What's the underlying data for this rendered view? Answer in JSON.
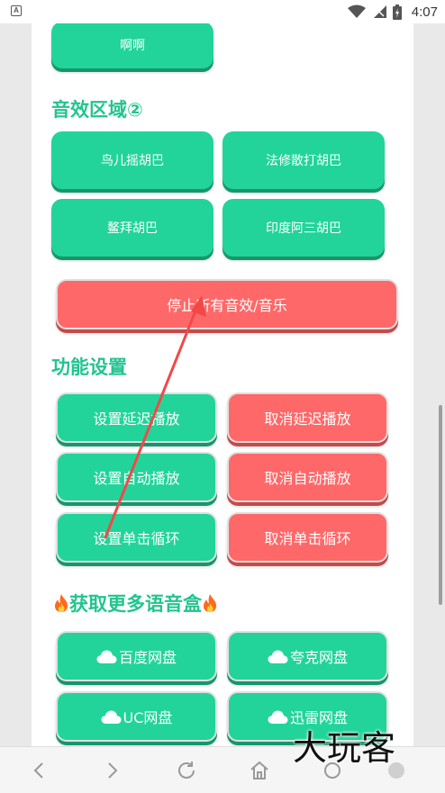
{
  "status_bar": {
    "time": "4:07",
    "app_icon": "A"
  },
  "top_partial": {
    "button_label": "啊啊"
  },
  "sound_section": {
    "title": "音效区域②",
    "buttons": [
      "鸟儿摇胡巴",
      "法修散打胡巴",
      "鳌拜胡巴",
      "印度阿三胡巴"
    ]
  },
  "stop_button": {
    "label": "停止所有音效/音乐"
  },
  "settings_section": {
    "title": "功能设置",
    "buttons": {
      "set_delay": "设置延迟播放",
      "cancel_delay": "取消延迟播放",
      "set_auto": "设置自动播放",
      "cancel_auto": "取消自动播放",
      "set_loop": "设置单击循环",
      "cancel_loop": "取消单击循环"
    }
  },
  "more_section": {
    "title": "获取更多语音盒",
    "buttons": [
      "百度网盘",
      "夸克网盘",
      "UC网盘",
      "迅雷网盘"
    ]
  },
  "watermark": "大玩客",
  "colors": {
    "green": "#22d49a",
    "red": "#ff6868",
    "title_green": "#22c48f",
    "arrow": "#f24848"
  }
}
